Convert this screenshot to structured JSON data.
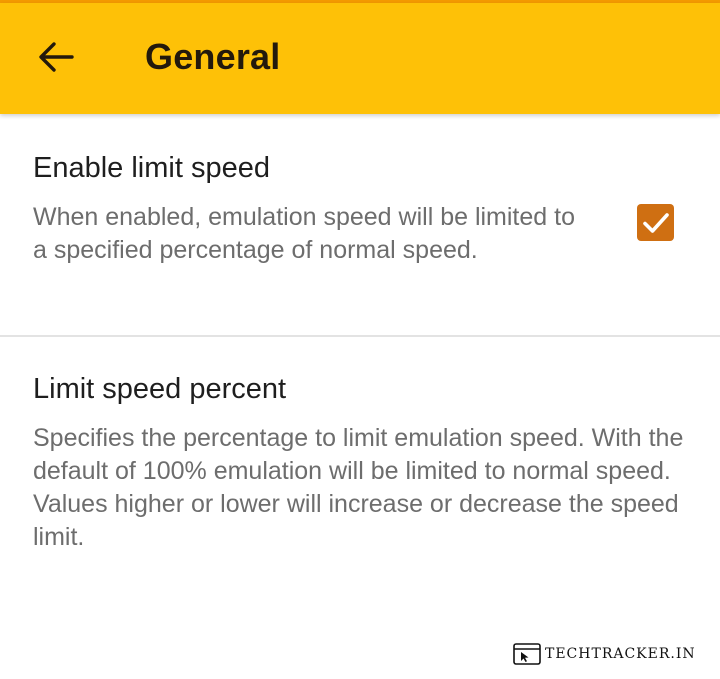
{
  "app_bar": {
    "back_icon": "arrow-left-icon",
    "title": "General",
    "background": "#fec107"
  },
  "preferences": [
    {
      "title": "Enable limit speed",
      "summary": "When enabled, emulation speed will be limited to a specified percentage of normal speed.",
      "checked": true,
      "checkbox_color": "#cf6f12"
    },
    {
      "title": "Limit speed percent",
      "summary": "Specifies the percentage to limit emulation speed. With the default of 100% emulation will be limited to normal speed. Values higher or lower will increase or decrease the speed limit."
    }
  ],
  "watermark": {
    "icon": "browser-cursor-icon",
    "text": "TECHTRACKER.IN"
  }
}
